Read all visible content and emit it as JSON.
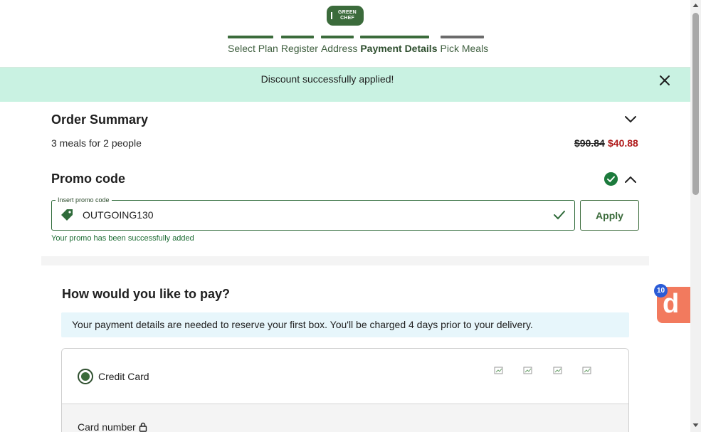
{
  "header": {
    "logo_text": "GREEN CHEF",
    "steps": [
      {
        "label": "Select Plan",
        "state": "done"
      },
      {
        "label": "Register",
        "state": "done"
      },
      {
        "label": "Address",
        "state": "done"
      },
      {
        "label": "Payment Details",
        "state": "active"
      },
      {
        "label": "Pick Meals",
        "state": "future"
      }
    ]
  },
  "banner": {
    "message": "Discount successfully applied!",
    "close_icon": "close-icon"
  },
  "order_summary": {
    "title": "Order Summary",
    "meals": "3 meals for 2 people",
    "original_price": "$90.84",
    "discounted_price": "$40.88"
  },
  "promo": {
    "title": "Promo code",
    "field_label": "Insert promo code",
    "value": "OUTGOING130",
    "apply_label": "Apply",
    "success_message": "Your promo has been successfully added"
  },
  "payment": {
    "title": "How would you like to pay?",
    "info": "Your payment details are needed to reserve your first box. You'll be charged 4 days prior to your delivery.",
    "method_label": "Credit Card",
    "card_number_label": "Card number"
  },
  "widget": {
    "letter": "d",
    "badge_count": "10"
  },
  "colors": {
    "brand_green": "#3b6b3b",
    "banner_bg": "#c9f2e2",
    "sale_red": "#b01a1a",
    "success_green": "#1c7a3c",
    "widget_orange": "#f27a5e",
    "badge_blue": "#2a5bd7"
  }
}
